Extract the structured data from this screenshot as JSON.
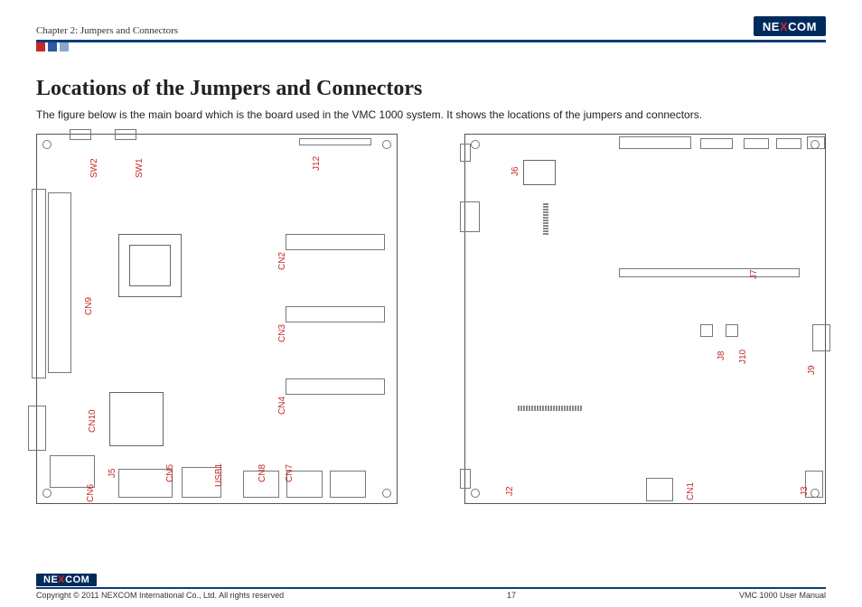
{
  "header": {
    "chapter": "Chapter 2: Jumpers and Connectors",
    "brand_pre": "NE",
    "brand_x": "X",
    "brand_post": "COM"
  },
  "title": "Locations of the Jumpers and Connectors",
  "intro": "The figure below is the main board which is the board used in the VMC 1000 system. It shows the locations of the jumpers and connectors.",
  "board_left_labels": {
    "sw2": "SW2",
    "sw1": "SW1",
    "j12": "J12",
    "cn9": "CN9",
    "cn2": "CN2",
    "cn3": "CN3",
    "cn4": "CN4",
    "cn10": "CN10",
    "j5": "J5",
    "cn5": "CN5",
    "usb1": "USB1",
    "cn8": "CN8",
    "cn7": "CN7",
    "cn6": "CN6"
  },
  "board_right_labels": {
    "j6": "J6",
    "j7": "J7",
    "j8": "J8",
    "j10": "J10",
    "j9": "J9",
    "j2": "J2",
    "cn1": "CN1",
    "j3": "J3"
  },
  "footer": {
    "copyright": "Copyright © 2011 NEXCOM International Co., Ltd. All rights reserved",
    "page": "17",
    "doc": "VMC 1000 User Manual"
  }
}
